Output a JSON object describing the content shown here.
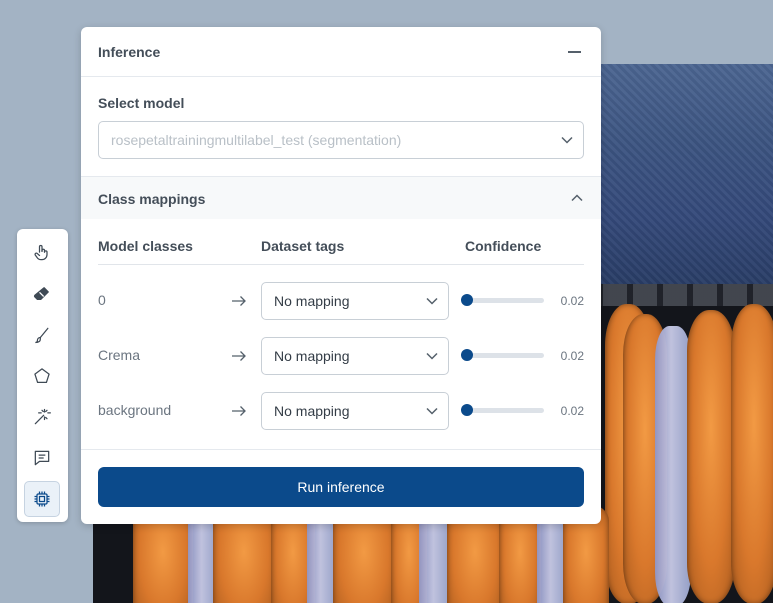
{
  "panel": {
    "title": "Inference",
    "select_model_label": "Select model",
    "model_value": "rosepetaltrainingmultilabel_test (segmentation)",
    "class_mappings_title": "Class mappings",
    "columns": {
      "model_classes": "Model classes",
      "dataset_tags": "Dataset tags",
      "confidence": "Confidence"
    },
    "rows": [
      {
        "model_class": "0",
        "dataset_tag": "No mapping",
        "confidence": 0.02,
        "confidence_label": "0.02"
      },
      {
        "model_class": "Crema",
        "dataset_tag": "No mapping",
        "confidence": 0.02,
        "confidence_label": "0.02"
      },
      {
        "model_class": "background",
        "dataset_tag": "No mapping",
        "confidence": 0.02,
        "confidence_label": "0.02"
      }
    ],
    "run_button": "Run inference"
  },
  "toolbar": {
    "tools": [
      {
        "icon": "hand-pointer-icon",
        "active": false
      },
      {
        "icon": "eraser-icon",
        "active": false
      },
      {
        "icon": "brush-icon",
        "active": false
      },
      {
        "icon": "polygon-icon",
        "active": false
      },
      {
        "icon": "magic-wand-icon",
        "active": false
      },
      {
        "icon": "comment-icon",
        "active": false
      },
      {
        "icon": "cpu-chip-icon",
        "active": true
      }
    ]
  },
  "colors": {
    "primary": "#0b4a8b",
    "text": "#444e59",
    "muted": "#6b7580",
    "placeholder": "#b9c0c7",
    "background": "#a3b3c4"
  }
}
